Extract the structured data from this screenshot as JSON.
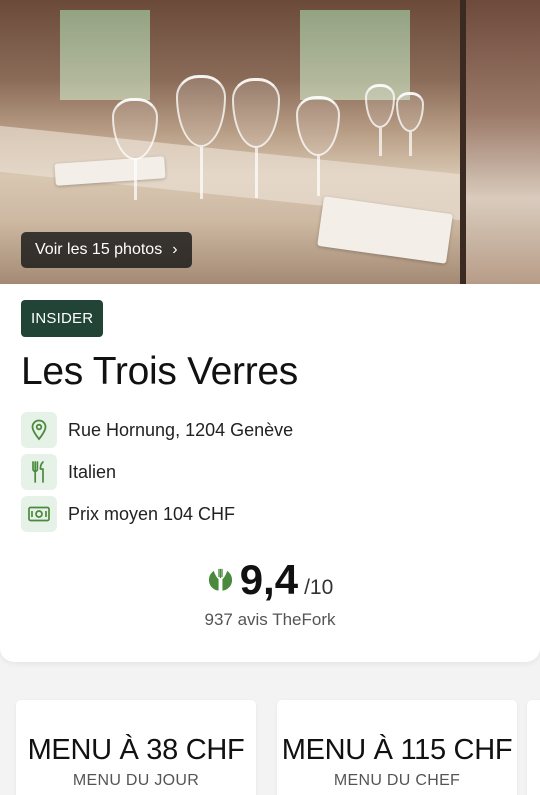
{
  "gallery": {
    "photos_button_label": "Voir les 15 photos",
    "chevron_glyph": "›"
  },
  "restaurant": {
    "badge": "INSIDER",
    "name": "Les Trois Verres",
    "address": "Rue Hornung, 1204 Genève",
    "cuisine": "Italien",
    "price": "Prix moyen 104 CHF",
    "icons": [
      "location-pin-icon",
      "fork-knife-icon",
      "banknote-icon"
    ],
    "accent_color": "#4a8a3c",
    "badge_color": "#214437"
  },
  "rating": {
    "score": "9,4",
    "out_of": "/10",
    "reviews": "937 avis TheFork",
    "score_value": 9.4,
    "scale": 10
  },
  "offers": [
    {
      "title": "MENU À 38 CHF",
      "subtitle": "MENU DU JOUR"
    },
    {
      "title": "MENU À 115 CHF",
      "subtitle": "MENU DU CHEF"
    }
  ]
}
